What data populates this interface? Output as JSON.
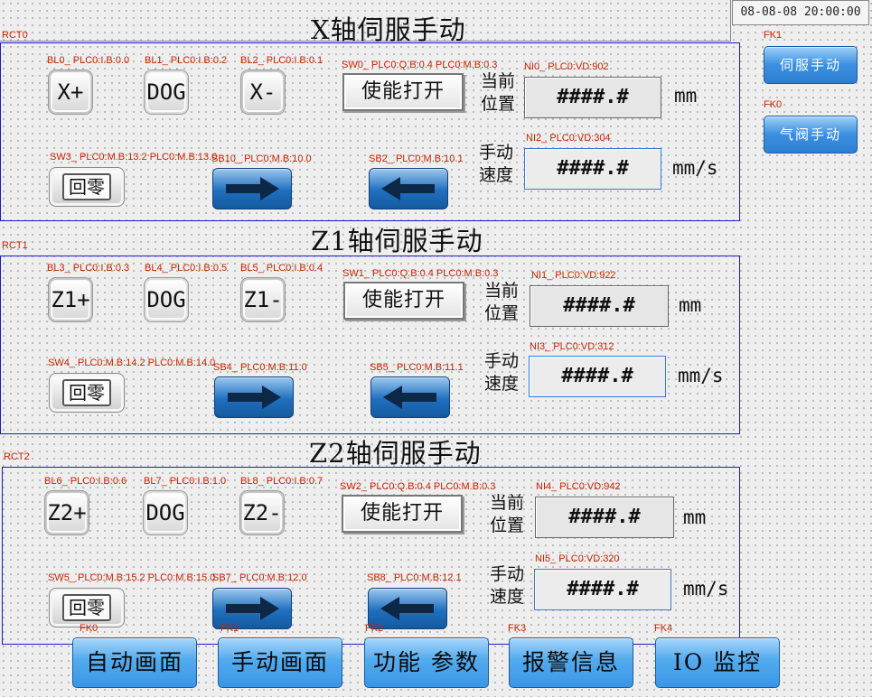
{
  "datetime": "08-08-08  20:00:00",
  "colors": {
    "panel_border": "#1a1acc",
    "tag_text": "#cc2200",
    "button_blue": "#3a97e6",
    "arrow_blue": "#1f6fc0"
  },
  "side_buttons": [
    {
      "tag": "FK1",
      "label": "伺服手动"
    },
    {
      "tag": "FK0",
      "label": "气阀手动"
    }
  ],
  "sections": [
    {
      "rct": "RCT0",
      "title": "X轴伺服手动",
      "keys": [
        {
          "tag": "BL0_ PLC0:I.B:0.0",
          "label": "X+"
        },
        {
          "tag": "BL1_ PLC0:I.B:0.2",
          "label": "DOG"
        },
        {
          "tag": "BL2_ PLC0:I.B:0.1",
          "label": "X-"
        }
      ],
      "enable": {
        "tag": "SW0_ PLC0:Q.B:0.4 PLC0:M.B:0.3",
        "label": "使能打开"
      },
      "zero": {
        "tag": "SW3_ PLC0:M.B:13.2 PLC0:M.B:13.0",
        "label": "回零"
      },
      "fwd": {
        "tag": "SB10_ PLC0:M.B:10.0",
        "icon": "arrow-right-icon"
      },
      "back": {
        "tag": "SB2_ PLC0:M.B:10.1",
        "icon": "arrow-left-icon"
      },
      "pos": {
        "tag": "NI0_ PLC0:VD:902",
        "label1": "当前",
        "label2": "位置",
        "value": "####.#",
        "unit": "mm"
      },
      "speed": {
        "tag": "NI2_ PLC0:VD:304",
        "label1": "手动",
        "label2": "速度",
        "value": "####.#",
        "unit": "mm/s"
      }
    },
    {
      "rct": "RCT1",
      "title": "Z1轴伺服手动",
      "keys": [
        {
          "tag": "BL3_ PLC0:I.B:0.3",
          "label": "Z1+"
        },
        {
          "tag": "BL4_ PLC0:I.B:0.5",
          "label": "DOG"
        },
        {
          "tag": "BL5_ PLC0:I.B:0.4",
          "label": "Z1-"
        }
      ],
      "enable": {
        "tag": "SW1_ PLC0:Q.B:0.4 PLC0:M.B:0.3",
        "label": "使能打开"
      },
      "zero": {
        "tag": "SW4_ PLC0:M.B:14.2 PLC0:M.B:14.0",
        "label": "回零"
      },
      "fwd": {
        "tag": "SB4_ PLC0:M.B:11.0",
        "icon": "arrow-right-icon"
      },
      "back": {
        "tag": "SB5_ PLC0:M.B:11.1",
        "icon": "arrow-left-icon"
      },
      "pos": {
        "tag": "NI1_ PLC0:VD:922",
        "label1": "当前",
        "label2": "位置",
        "value": "####.#",
        "unit": "mm"
      },
      "speed": {
        "tag": "NI3_ PLC0:VD:312",
        "label1": "手动",
        "label2": "速度",
        "value": "####.#",
        "unit": "mm/s"
      }
    },
    {
      "rct": "RCT2",
      "title": "Z2轴伺服手动",
      "keys": [
        {
          "tag": "BL6_ PLC0:I.B:0.6",
          "label": "Z2+"
        },
        {
          "tag": "BL7_ PLC0:I.B:1.0",
          "label": "DOG"
        },
        {
          "tag": "BL8_ PLC0:I.B:0.7",
          "label": "Z2-"
        }
      ],
      "enable": {
        "tag": "SW2_ PLC0:Q.B:0.4 PLC0:M.B:0.3",
        "label": "使能打开"
      },
      "zero": {
        "tag": "SW5_ PLC0:M.B:15.2 PLC0:M.B:15.0",
        "label": "回零"
      },
      "fwd": {
        "tag": "SB7_ PLC0:M.B:12.0",
        "icon": "arrow-right-icon"
      },
      "back": {
        "tag": "SB8_ PLC0:M.B:12.1",
        "icon": "arrow-left-icon"
      },
      "pos": {
        "tag": "NI4_ PLC0:VD:942",
        "label1": "当前",
        "label2": "位置",
        "value": "####.#",
        "unit": "mm"
      },
      "speed": {
        "tag": "NI5_ PLC0:VD:320",
        "label1": "手动",
        "label2": "速度",
        "value": "####.#",
        "unit": "mm/s"
      }
    }
  ],
  "nav": [
    {
      "tag": "FK0",
      "label": "自动画面"
    },
    {
      "tag": "FK1",
      "label": "手动画面"
    },
    {
      "tag": "FK2",
      "label": "功能 参数"
    },
    {
      "tag": "FK3",
      "label": "报警信息"
    },
    {
      "tag": "FK4",
      "label": "IO 监控"
    }
  ]
}
